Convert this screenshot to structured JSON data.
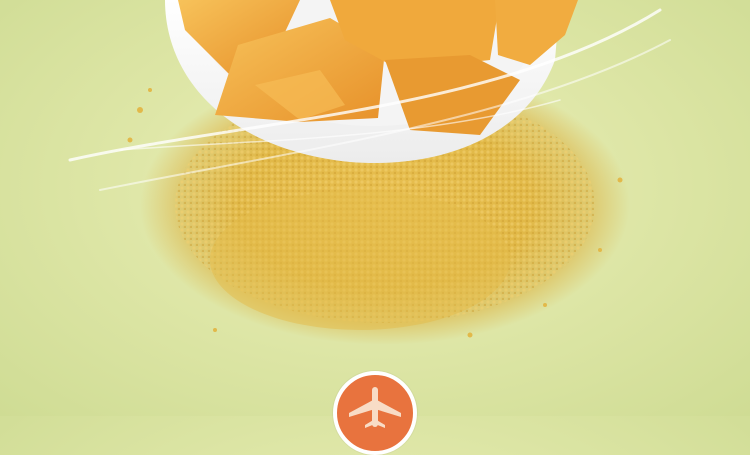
{
  "scene": {
    "subject": "millet-crisps-in-bowl",
    "colors": {
      "background": "#dfe7a8",
      "millet": "#e3b948",
      "chip": "#f0ab3c",
      "bowl": "#ffffff",
      "badge": "#e8733e"
    }
  },
  "badge": {
    "icon": "airplane-icon"
  }
}
